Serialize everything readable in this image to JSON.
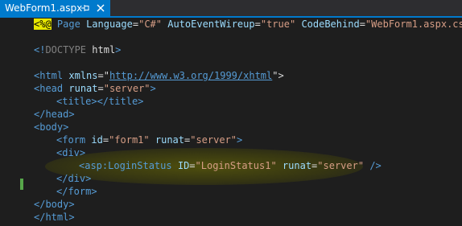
{
  "tab": {
    "title": "WebForm1.aspx",
    "pin_icon": "pin-icon",
    "close_icon": "close-icon"
  },
  "colors": {
    "active_tab": "#007acc",
    "editor_bg": "#1e1e1e",
    "highlight": "#5a5a00",
    "change_marker": "#57a64a"
  },
  "code": {
    "line1": {
      "directive_open": "<%@",
      "page_kw": "Page",
      "lang_attr": "Language",
      "lang_val": "\"C#\"",
      "auto_attr": "AutoEventWireup",
      "auto_val": "\"true\"",
      "cb_attr": "CodeBehind",
      "cb_val": "\"WebForm1.aspx.cs\""
    },
    "doctype": {
      "open": "<!",
      "kw": "DOCTYPE",
      "text": "html",
      "close": ">"
    },
    "html_open": {
      "lt": "<",
      "tag": "html",
      "attr": "xmlns",
      "eq_quote": "=\"",
      "url": "http://www.w3.org/1999/xhtml",
      "quote_gt": "\">"
    },
    "head_open": {
      "lt": "<",
      "tag": "head",
      "attr": "runat",
      "val": "\"server\"",
      "gt": ">"
    },
    "title_line": {
      "open": "<",
      "tag": "title",
      "mid": "></",
      "tag2": "title",
      "close": ">"
    },
    "head_close": {
      "open": "</",
      "tag": "head",
      "close": ">"
    },
    "body_open": {
      "open": "<",
      "tag": "body",
      "close": ">"
    },
    "form_open": {
      "lt": "<",
      "tag": "form",
      "id_attr": "id",
      "id_val": "\"form1\"",
      "runat_attr": "runat",
      "runat_val": "\"server\"",
      "gt": ">"
    },
    "div_open": {
      "open": "<",
      "tag": "div",
      "close": ">"
    },
    "login_status": {
      "lt": "<",
      "tag": "asp:LoginStatus",
      "id_attr": "ID",
      "id_val": "\"LoginStatus1\"",
      "runat_attr": "runat",
      "runat_val": "\"server\"",
      "close": "/>"
    },
    "div_close": {
      "open": "</",
      "tag": "div",
      "close": ">"
    },
    "form_close": {
      "open": "</",
      "tag": "form",
      "close": ">"
    },
    "body_close": {
      "open": "</",
      "tag": "body",
      "close": ">"
    },
    "html_close": {
      "open": "</",
      "tag": "html",
      "close": ">"
    }
  }
}
